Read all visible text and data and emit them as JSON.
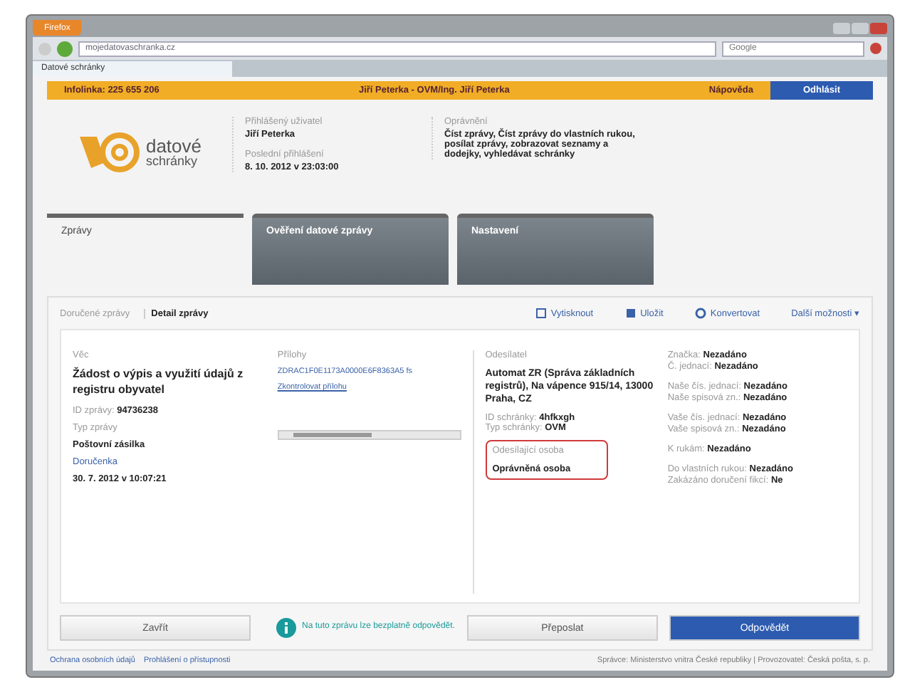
{
  "browser": {
    "menu_button": "Firefox",
    "address": "mojedatovaschranka.cz",
    "search_placeholder": "Google",
    "tab_title": "Datové schránky"
  },
  "topbar": {
    "hotline": "Infolinka: 225 655 206",
    "account": "Jiří Peterka - OVM/Ing. Jiří Peterka",
    "help": "Nápověda",
    "logout": "Odhlásit"
  },
  "logo": {
    "word1": "datové",
    "word2": "schránky"
  },
  "user": {
    "user_label": "Přihlášený uživatel",
    "user_name": "Jiří Peterka",
    "login_label": "Poslední přihlášení",
    "login_time": "8. 10. 2012 v 23:03:00",
    "rights_label": "Oprávnění",
    "rights": "Číst zprávy, Číst zprávy do vlastních rukou, posílat zprávy, zobrazovat seznamy a dodejky, vyhledávat schránky"
  },
  "tabs": [
    {
      "label": "Zprávy",
      "selected": true
    },
    {
      "label": "Ověření datové zprávy",
      "selected": false
    },
    {
      "label": "Nastavení",
      "selected": false
    }
  ],
  "breadcrumb": [
    "Doručené zprávy",
    "Detail zprávy"
  ],
  "actions": [
    {
      "label": "Vytisknout"
    },
    {
      "label": "Uložit"
    },
    {
      "label": "Konvertovat"
    },
    {
      "label": "Další možnosti ▾"
    }
  ],
  "message": {
    "subject_label": "Věc",
    "subject": "Žádost o výpis a využití údajů z registru obyvatel",
    "id_label": "ID zprávy:",
    "id": "94736238",
    "type_label": "Typ zprávy",
    "type": "Poštovní zásilka",
    "receipt_link": "Doručenka",
    "receipt_time": "30. 7. 2012 v 10:07:21"
  },
  "attachments": {
    "label": "Přílohy",
    "file": "ZDRAC1F0E1173A0000E6F8363A5",
    "file_end": "fs",
    "check_link": "Zkontrolovat přílohu"
  },
  "sender": {
    "label": "Odesílatel",
    "name": "Automat ZR (Správa základních registrů), Na vápence 915/14, 13000 Praha, CZ",
    "box_id_label": "ID schránky:",
    "box_id": "4hfkxgh",
    "box_type_label": "Typ schránky:",
    "box_type": "OVM",
    "person_label": "Odesílající osoba",
    "person": "Oprávněná osoba",
    "highlighted": true
  },
  "details": [
    [
      {
        "label": "Značka:",
        "value": "Nezadáno"
      },
      {
        "label": "Č. jednací:",
        "value": "Nezadáno"
      }
    ],
    [
      {
        "label": "Naše čís. jednací:",
        "value": "Nezadáno"
      },
      {
        "label": "Naše spisová zn.:",
        "value": "Nezadáno"
      }
    ],
    [
      {
        "label": "Vaše čís. jednací:",
        "value": "Nezadáno"
      },
      {
        "label": "Vaše spisová zn.:",
        "value": "Nezadáno"
      }
    ],
    [
      {
        "label": "K rukám:",
        "value": "Nezadáno"
      }
    ],
    [
      {
        "label": "Do vlastních rukou:",
        "value": "Nezadáno"
      },
      {
        "label": "Zakázáno doručení fikcí:",
        "value": "Ne"
      }
    ]
  ],
  "footer_buttons": {
    "close": "Zavřít",
    "info": "Na tuto zprávu lze bezplatně odpovědět.",
    "forward": "Přeposlat",
    "reply": "Odpovědět"
  },
  "status_bar": {
    "links": [
      "Ochrana osobních údajů",
      "Prohlášení o přístupnosti"
    ],
    "right": "Správce: Ministerstvo vnitra České republiky | Provozovatel: Česká pošta, s. p."
  }
}
